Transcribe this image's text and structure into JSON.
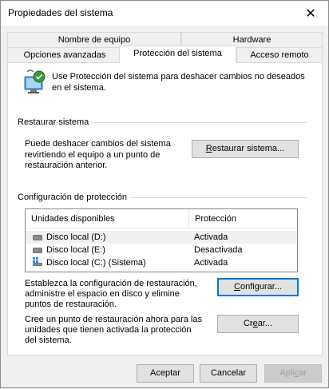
{
  "window": {
    "title": "Propiedades del sistema"
  },
  "tabs": {
    "row1": [
      "Nombre de equipo",
      "Hardware"
    ],
    "row2": [
      "Opciones avanzadas",
      "Protección del sistema",
      "Acceso remoto"
    ]
  },
  "intro": {
    "text": "Use Protección del sistema para deshacer cambios no deseados en el sistema."
  },
  "restore": {
    "section_label": "Restaurar sistema",
    "description": "Puede deshacer cambios del sistema revirtiendo el equipo a un punto de restauración anterior.",
    "button": {
      "pre": "",
      "key": "R",
      "post": "estaurar sistema..."
    }
  },
  "protection": {
    "section_label": "Configuración de protección",
    "columns": [
      "Unidades disponibles",
      "Protección"
    ],
    "rows": [
      {
        "drive": "Disco local (D:)",
        "status": "Activada"
      },
      {
        "drive": "Disco local (E:)",
        "status": "Desactivada"
      },
      {
        "drive": "Disco local (C:) (Sistema)",
        "status": "Activada"
      }
    ],
    "configure_text": "Establezca la configuración de restauración, administre el espacio en disco y elimine puntos de restauración.",
    "configure_button": {
      "pre": "",
      "key": "C",
      "post": "onfigurar..."
    },
    "create_text": "Cree un punto de restauración ahora para las unidades que tienen activada la protección del sistema.",
    "create_button": {
      "pre": "Cr",
      "key": "e",
      "post": "ar..."
    }
  },
  "footer": {
    "accept": "Aceptar",
    "cancel": "Cancelar",
    "apply": {
      "pre": "Apli",
      "key": "c",
      "post": "ar"
    }
  },
  "colors": {
    "focus": "#0078d7",
    "disabled_text": "#a0a0a0"
  },
  "icons": [
    "close-icon",
    "system-protection-icon",
    "drive-icon",
    "system-drive-icon"
  ]
}
